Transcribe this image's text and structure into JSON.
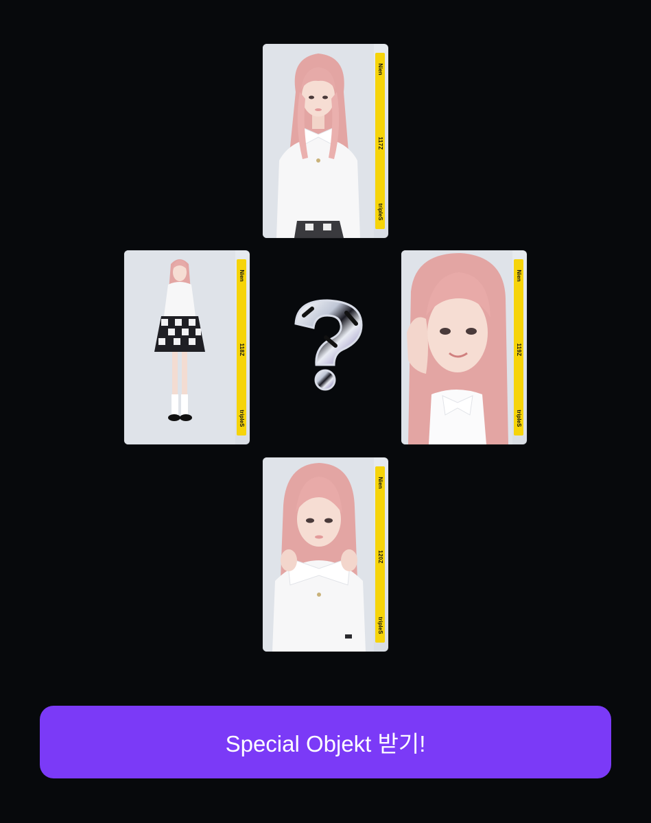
{
  "cards": [
    {
      "position": "top",
      "member": "Nien",
      "serial": "117Z",
      "brand": "tripleS",
      "pose": "portrait-bow"
    },
    {
      "position": "left",
      "member": "Nien",
      "serial": "118Z",
      "brand": "tripleS",
      "pose": "full-body-checkered-skirt"
    },
    {
      "position": "right",
      "member": "Nien",
      "serial": "119Z",
      "brand": "tripleS",
      "pose": "hand-on-cheek-closeup"
    },
    {
      "position": "bottom",
      "member": "Nien",
      "serial": "120Z",
      "brand": "tripleS",
      "pose": "holding-bow"
    }
  ],
  "center_icon": "question-mark-icon",
  "cta": {
    "label": "Special Objekt 받기!"
  },
  "colors": {
    "background": "#07090c",
    "card_band": "#f6d40a",
    "cta": "#7b3af7",
    "hair": "#e8a7a6"
  }
}
